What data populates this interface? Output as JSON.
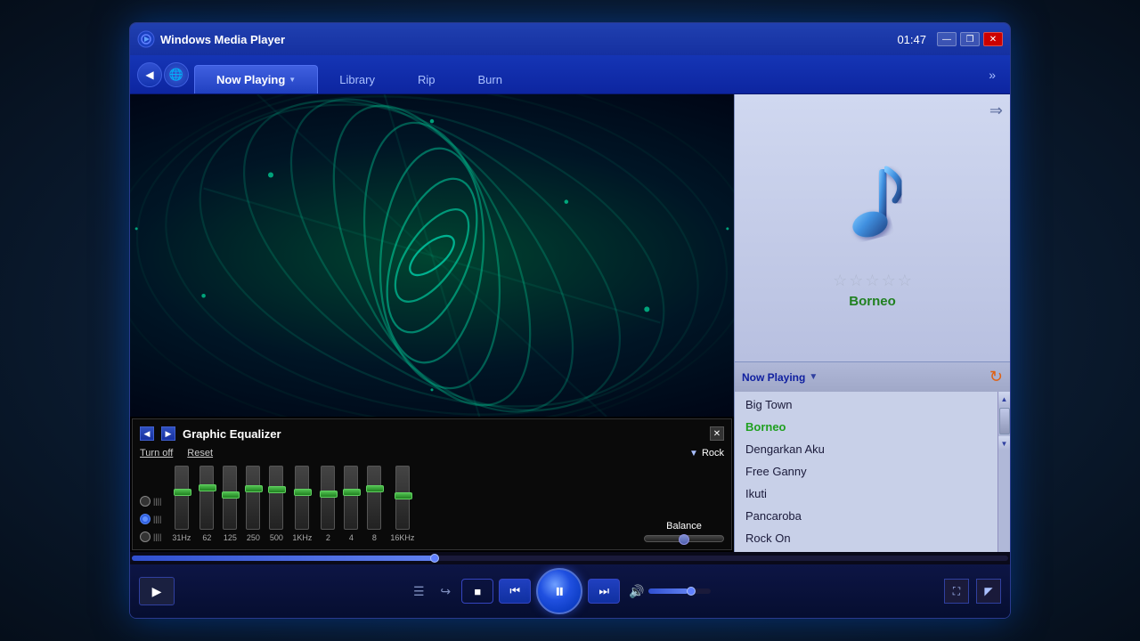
{
  "window": {
    "title": "Windows Media Player",
    "time": "01:47"
  },
  "titlebar": {
    "minimize": "—",
    "restore": "❐",
    "close": "✕"
  },
  "nav": {
    "back_label": "◀",
    "globe_label": "🌐",
    "tabs": [
      {
        "id": "now-playing",
        "label": "Now Playing",
        "active": true
      },
      {
        "id": "library",
        "label": "Library",
        "active": false
      },
      {
        "id": "rip",
        "label": "Rip",
        "active": false
      },
      {
        "id": "burn",
        "label": "Burn",
        "active": false
      }
    ],
    "more_label": "»"
  },
  "equalizer": {
    "title": "Graphic Equalizer",
    "turn_off": "Turn off",
    "reset": "Reset",
    "preset": "Rock",
    "close": "✕",
    "bands": [
      {
        "freq": "31Hz",
        "position": 55
      },
      {
        "freq": "62",
        "position": 45
      },
      {
        "freq": "125",
        "position": 40
      },
      {
        "freq": "250",
        "position": 42
      },
      {
        "freq": "500",
        "position": 38
      },
      {
        "freq": "1KHz",
        "position": 40
      },
      {
        "freq": "2",
        "position": 43
      },
      {
        "freq": "4",
        "position": 42
      },
      {
        "freq": "8",
        "position": 40
      },
      {
        "freq": "16KHz",
        "position": 52
      }
    ],
    "balance_label": "Balance"
  },
  "album": {
    "song_title": "Borneo",
    "stars": [
      "☆",
      "☆",
      "☆",
      "☆",
      "☆"
    ]
  },
  "playlist": {
    "header": "Now Playing",
    "items": [
      {
        "id": "big-town",
        "label": "Big Town",
        "active": false
      },
      {
        "id": "borneo",
        "label": "Borneo",
        "active": true
      },
      {
        "id": "dengarkan-aku",
        "label": "Dengarkan Aku",
        "active": false
      },
      {
        "id": "free-ganny",
        "label": "Free Ganny",
        "active": false
      },
      {
        "id": "ikuti",
        "label": "Ikuti",
        "active": false
      },
      {
        "id": "pancaroba",
        "label": "Pancaroba",
        "active": false
      },
      {
        "id": "rock-on",
        "label": "Rock On",
        "active": false
      }
    ]
  },
  "controls": {
    "stop_label": "■",
    "prev_label": "⏮",
    "play_pause_label": "⏸",
    "next_label": "⏭",
    "shuffle_label": "☰",
    "repeat_label": "↪",
    "volume_icon": "🔊",
    "fullscreen_label": "⛶",
    "mini_label": "◤"
  }
}
